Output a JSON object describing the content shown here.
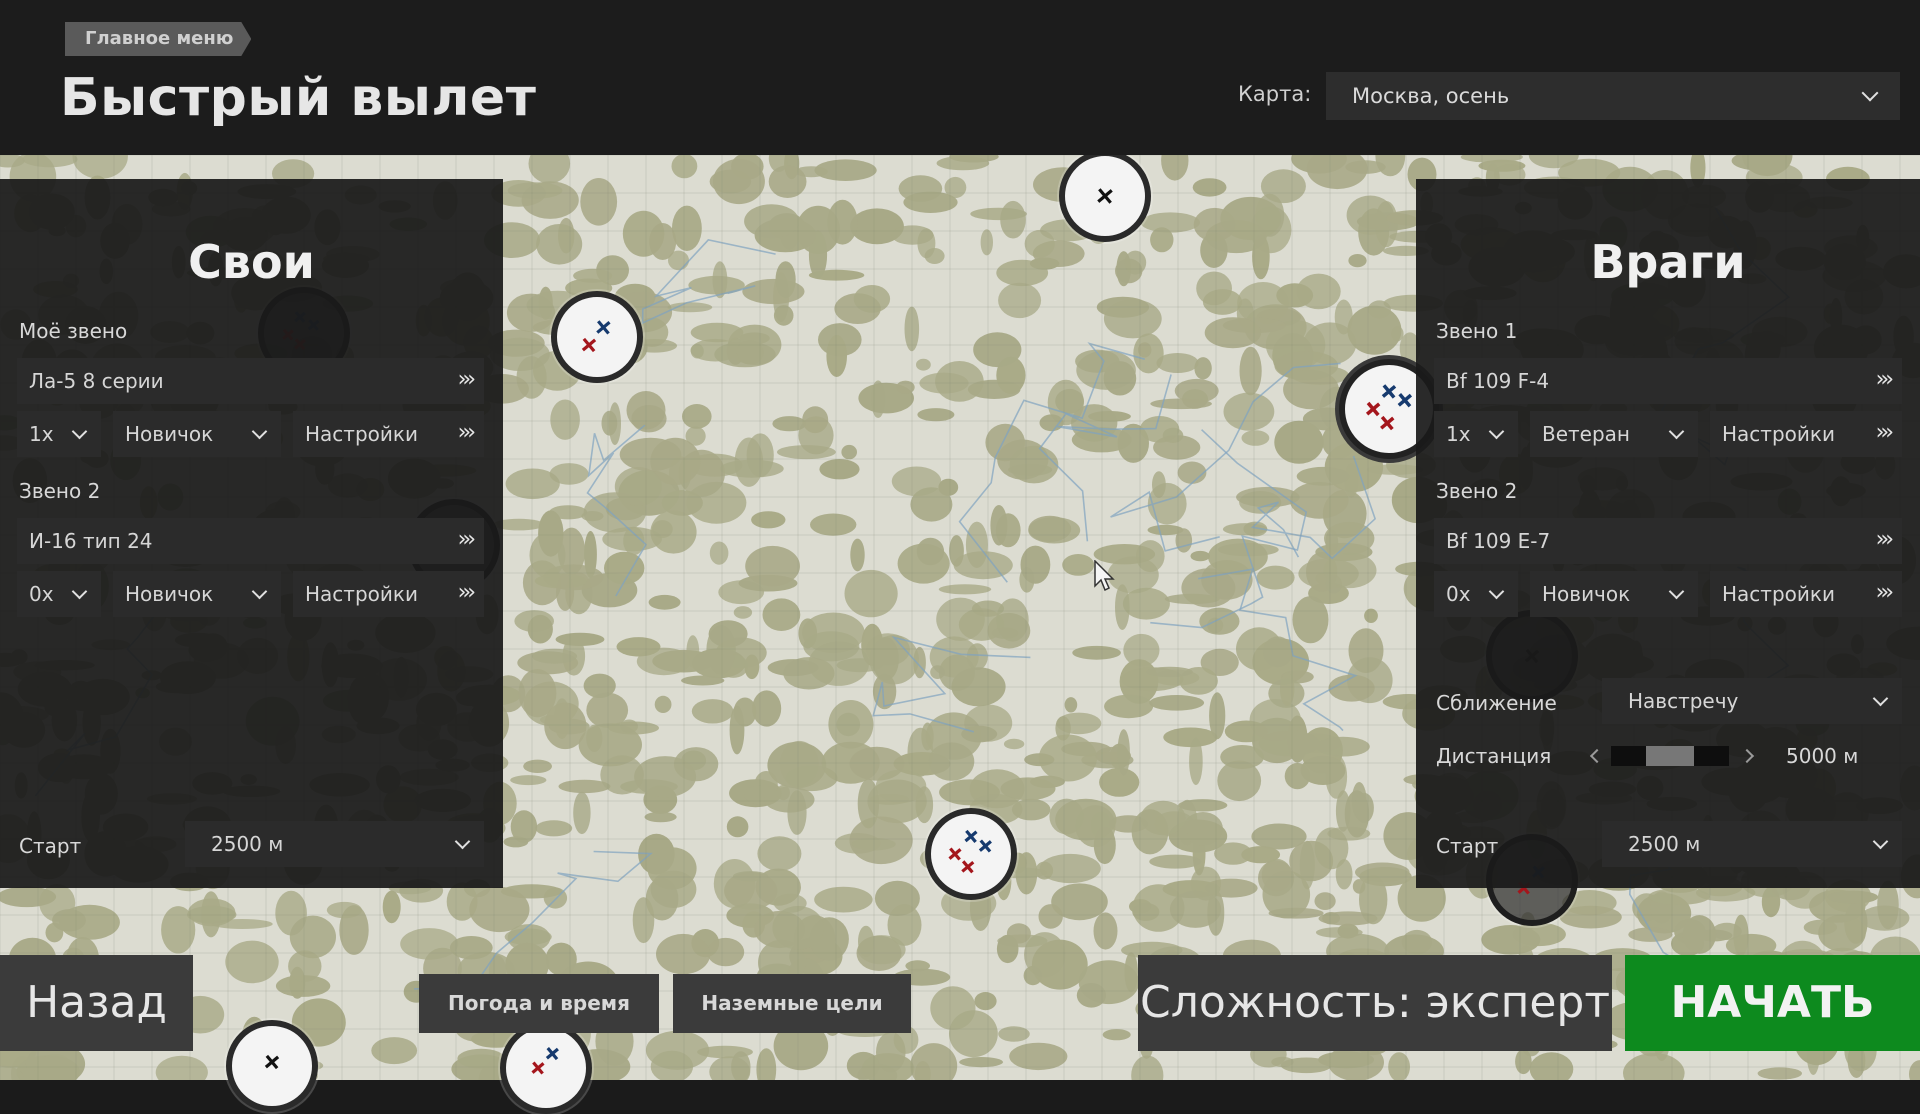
{
  "header": {
    "breadcrumb": "Главное меню",
    "title": "Быстрый вылет",
    "map_label": "Карта:",
    "map_value": "Москва, осень"
  },
  "friends": {
    "title": "Свои",
    "flights": [
      {
        "label": "Моё звено",
        "aircraft": "Ла-5 8 серии",
        "count": "1х",
        "skill": "Новичок",
        "settings": "Настройки"
      },
      {
        "label": "Звено 2",
        "aircraft": "И-16 тип 24",
        "count": "0х",
        "skill": "Новичок",
        "settings": "Настройки"
      }
    ],
    "start_label": "Старт",
    "start_value": "2500 м"
  },
  "enemies": {
    "title": "Враги",
    "flights": [
      {
        "label": "Звено 1",
        "aircraft": "Bf 109 F-4",
        "count": "1х",
        "skill": "Ветеран",
        "settings": "Настройки"
      },
      {
        "label": "Звено 2",
        "aircraft": "Bf 109 E-7",
        "count": "0х",
        "skill": "Новичок",
        "settings": "Настройки"
      }
    ],
    "approach_label": "Сближение",
    "approach_value": "Навстречу",
    "distance_label": "Дистанция",
    "distance_value": "5000 м",
    "distance_fraction": 0.4,
    "start_label": "Старт",
    "start_value": "2500 м"
  },
  "bottom": {
    "back": "Назад",
    "weather": "Погода и время",
    "ground_targets": "Наземные цели",
    "difficulty": "Сложность: эксперт",
    "start": "НАЧАТЬ"
  },
  "colors": {
    "accent_start": "#0d8a1e",
    "friendly": "#a4161c",
    "enemy": "#163a6e",
    "forest": "#a8a987"
  }
}
